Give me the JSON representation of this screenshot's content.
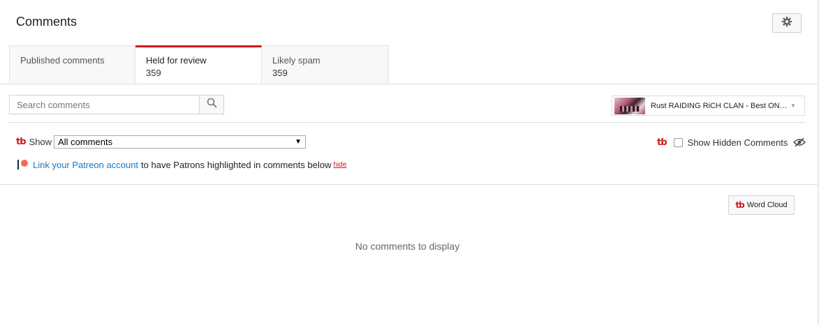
{
  "header": {
    "title": "Comments",
    "settings_icon": "gear-icon"
  },
  "tabs": [
    {
      "label": "Published comments",
      "count": ""
    },
    {
      "label": "Held for review",
      "count": "359",
      "active": true
    },
    {
      "label": "Likely spam",
      "count": "359"
    }
  ],
  "search": {
    "placeholder": "Search comments",
    "value": "",
    "icon": "search-icon"
  },
  "video_selector": {
    "title": "Rust RAIDING RiCH CLAN - Best ONLI...",
    "thumbnail_icon": "video-thumbnail"
  },
  "filter": {
    "brand_icon": "tubebuddy-icon",
    "show_label": "Show",
    "selected": "All comments"
  },
  "patreon": {
    "link_text": "Link your Patreon account",
    "text": "to have Patrons highlighted in comments below",
    "hide_label": "hide"
  },
  "hidden_comments": {
    "label": "Show Hidden Comments",
    "checked": false,
    "icon": "eye-slash-icon"
  },
  "word_cloud": {
    "label": "Word Cloud"
  },
  "empty_state": {
    "message": "No comments to display"
  },
  "colors": {
    "accent": "#cc181e",
    "link": "#167ac6",
    "patreon": "#f96854"
  }
}
